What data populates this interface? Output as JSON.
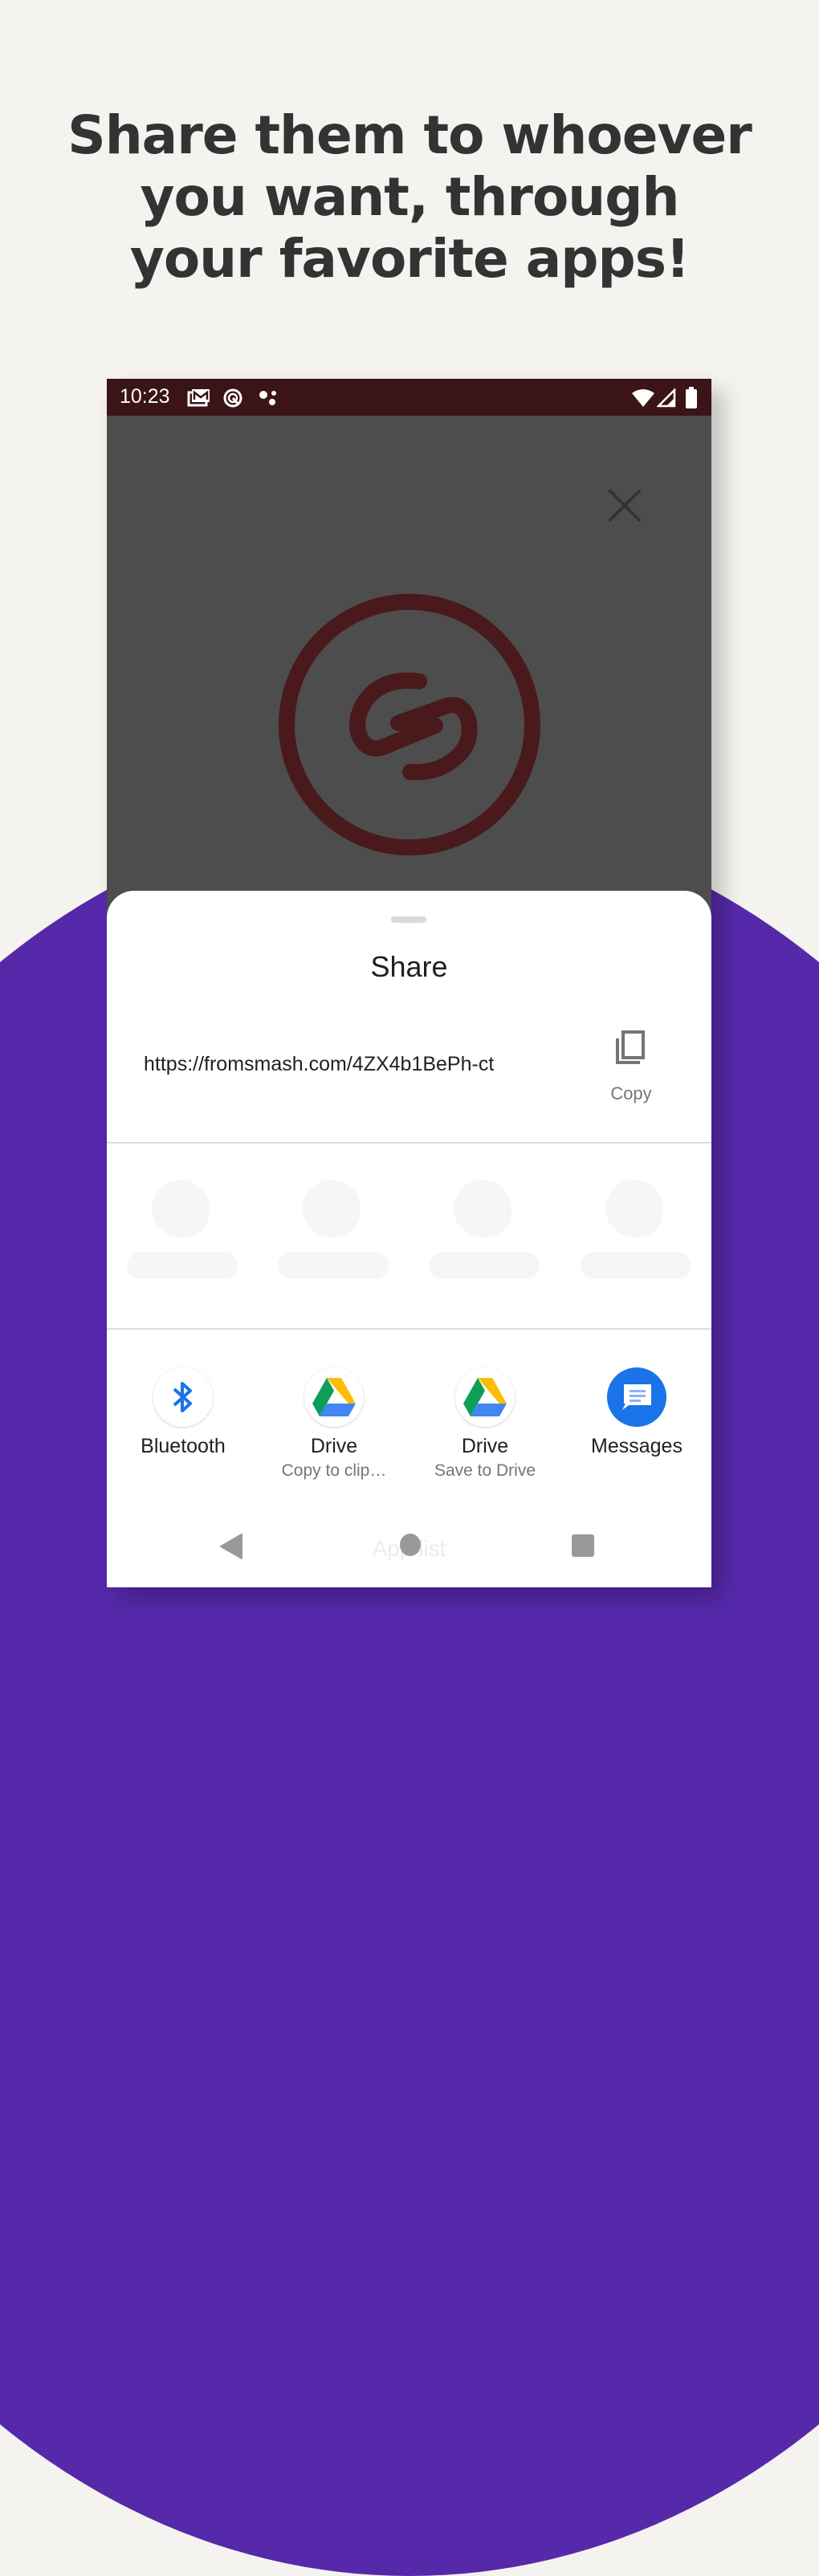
{
  "headline": {
    "lines": [
      "Share them to whoever",
      "you want, through",
      "your favorite apps!"
    ]
  },
  "colors": {
    "background": "#f5f3ef",
    "purple": "#5529aa",
    "status_bar": "#3a1416",
    "overlay": "#4d4d4d",
    "logo": "#4a191b",
    "accent_blue": "#1a73e8"
  },
  "status_bar": {
    "time": "10:23",
    "left_icons": [
      "gmail-icon",
      "data-saver-icon",
      "assistant-icon"
    ],
    "right_icons": [
      "wifi-icon",
      "signal-icon",
      "battery-icon"
    ]
  },
  "share_sheet": {
    "title": "Share",
    "url": "https://fromsmash.com/4ZX4b1BePh-ct",
    "copy_label": "Copy",
    "apps": [
      {
        "label": "Bluetooth",
        "sublabel": "",
        "icon": "bluetooth-icon"
      },
      {
        "label": "Drive",
        "sublabel": "Copy to clip…",
        "icon": "drive-icon"
      },
      {
        "label": "Drive",
        "sublabel": "Save to Drive",
        "icon": "drive-icon"
      },
      {
        "label": "Messages",
        "sublabel": "",
        "icon": "messages-icon"
      }
    ],
    "app_list_label": "App list"
  },
  "nav_bar": {
    "buttons": [
      "back-icon",
      "home-icon",
      "recents-icon"
    ]
  }
}
